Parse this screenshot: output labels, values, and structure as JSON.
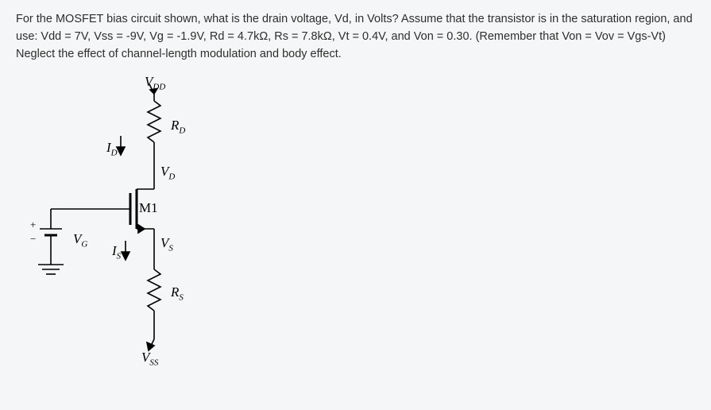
{
  "question": {
    "text": "For the MOSFET bias circuit shown, what is the drain voltage, Vd, in Volts? Assume that the transistor is in the saturation region, and use: Vdd = 7V, Vss = -9V, Vg = -1.9V, Rd = 4.7kΩ, Rs = 7.8kΩ, Vt = 0.4V, and Von = 0.30. (Remember that Von = Vov = Vgs-Vt) Neglect the effect of channel-length modulation and body effect."
  },
  "labels": {
    "vdd": "V",
    "vdd_sub": "DD",
    "rd": "R",
    "rd_sub": "D",
    "id": "I",
    "id_sub": "D",
    "vd": "V",
    "vd_sub": "D",
    "m1": "M1",
    "vg": "V",
    "vg_sub": "G",
    "is": "I",
    "is_sub": "S",
    "vs": "V",
    "vs_sub": "S",
    "rs": "R",
    "rs_sub": "S",
    "vss": "V",
    "vss_sub": "SS",
    "plus": "+",
    "minus": "−"
  }
}
